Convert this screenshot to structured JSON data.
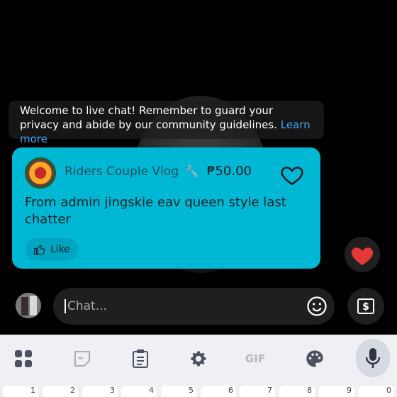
{
  "welcome": {
    "text": "Welcome to live chat! Remember to guard your privacy and abide by our community guidelines.",
    "link": "Learn more"
  },
  "superchat": {
    "channel_name": "Riders Couple Vlog",
    "badge_icon": "wrench-icon",
    "amount": "₱50.00",
    "message": "From admin jingskie eav queen style last chatter",
    "like_label": "Like"
  },
  "chat": {
    "placeholder": "Chat..."
  },
  "keyboard": {
    "toolbar": [
      "apps-icon",
      "sticker-icon",
      "clipboard-icon",
      "gear-icon",
      "GIF",
      "palette-icon",
      "mic-icon"
    ],
    "gif_label": "GIF",
    "number_row": [
      "1",
      "2",
      "3",
      "4",
      "5",
      "6",
      "7",
      "8",
      "9",
      "0"
    ]
  },
  "colors": {
    "superchat_bg": "#00b8d4",
    "link": "#3ea6ff",
    "heart": "#e53935"
  }
}
